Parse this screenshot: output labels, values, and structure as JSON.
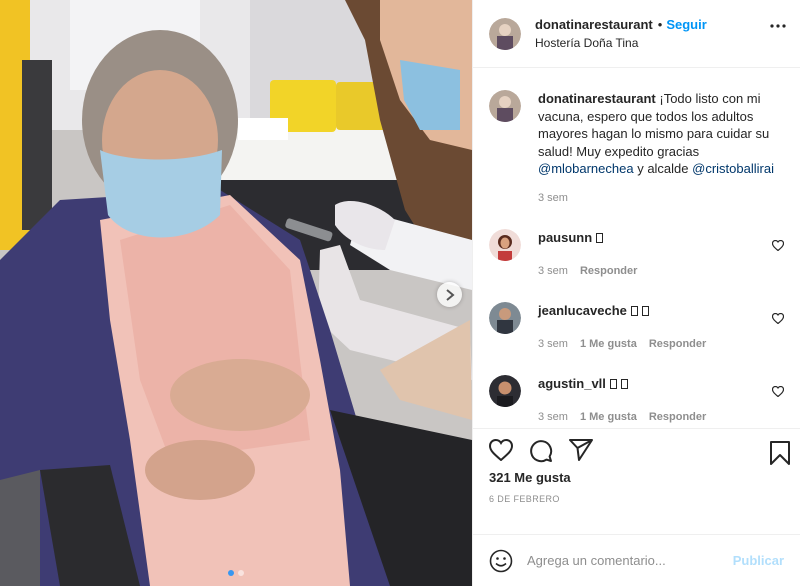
{
  "header": {
    "username": "donatinarestaurant",
    "separator": "•",
    "follow_label": "Seguir",
    "location": "Hostería Doña Tina",
    "more_icon": "more-options-icon"
  },
  "caption": {
    "username": "donatinarestaurant",
    "text": "¡Todo listo con mi vacuna, espero que todos los adultos mayores hagan lo mismo para cuidar su salud! Muy expedito gracias ",
    "mention1": "@mlobarnechea",
    "middle": " y alcalde ",
    "mention2": "@cristoballirai",
    "time": "3 sem"
  },
  "comments": [
    {
      "username": "pausunn",
      "time": "3 sem",
      "likes": "",
      "reply": "Responder"
    },
    {
      "username": "jeanlucaveche",
      "time": "3 sem",
      "likes": "1 Me gusta",
      "reply": "Responder"
    },
    {
      "username": "agustin_vll",
      "time": "3 sem",
      "likes": "1 Me gusta",
      "reply": "Responder"
    }
  ],
  "actions": {
    "like_icon": "heart-icon",
    "comment_icon": "comment-icon",
    "share_icon": "paper-plane-icon",
    "save_icon": "bookmark-icon"
  },
  "likes_text": "321 Me gusta",
  "date_text": "6 DE FEBRERO",
  "add_comment": {
    "placeholder": "Agrega un comentario...",
    "publish_label": "Publicar",
    "emoji_icon": "smiley-icon"
  },
  "carousel": {
    "slides": 2,
    "current": 1
  },
  "colors": {
    "link": "#0095f6",
    "mention": "#00376b",
    "muted": "#8e8e8e",
    "publish_disabled": "#b2dffc",
    "dot_active": "#3897f0"
  }
}
